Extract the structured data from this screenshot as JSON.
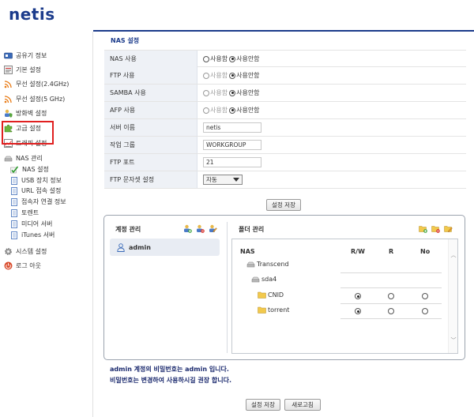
{
  "brand": {
    "logo": "netis",
    "accent": "#1b3b8b"
  },
  "sidebar": {
    "items": [
      {
        "label": "공유기 정보",
        "icon": "router-info-icon"
      },
      {
        "label": "기본 설정",
        "icon": "basic-settings-icon"
      },
      {
        "label": "무선 설정(2.4GHz)",
        "icon": "wireless-icon"
      },
      {
        "label": "무선 설정(5 GHz)",
        "icon": "wireless-icon"
      },
      {
        "label": "방화벽 설정",
        "icon": "firewall-icon"
      },
      {
        "label": "고급 설정",
        "icon": "puzzle-icon"
      },
      {
        "label": "트래픽 설정",
        "icon": "traffic-chart-icon"
      },
      {
        "label": "NAS 관리",
        "icon": "nas-drive-icon"
      },
      {
        "label": "시스템 설정",
        "icon": "gear-icon"
      },
      {
        "label": "로그 아웃",
        "icon": "power-icon"
      }
    ],
    "nas_subitems": [
      {
        "label": "NAS 설정",
        "icon": "check-icon"
      },
      {
        "label": "USB 장치 정보",
        "icon": "document-icon"
      },
      {
        "label": "URL 접속 설정",
        "icon": "document-icon"
      },
      {
        "label": "접속자 연결 정보",
        "icon": "document-icon"
      },
      {
        "label": "토렌트",
        "icon": "document-icon"
      },
      {
        "label": "미디어 서버",
        "icon": "document-icon"
      },
      {
        "label": "iTunes 서버",
        "icon": "document-icon"
      }
    ]
  },
  "main": {
    "title": "NAS 설정",
    "rows": {
      "nas_use": {
        "label": "NAS 사용",
        "opt_on": "사용함",
        "opt_off": "사용안함",
        "selected": "off"
      },
      "ftp_use": {
        "label": "FTP 사용",
        "opt_on": "사용함",
        "opt_off": "사용안함",
        "selected": "off"
      },
      "samba_use": {
        "label": "SAMBA 사용",
        "opt_on": "사용함",
        "opt_off": "사용안함",
        "selected": "off"
      },
      "afp_use": {
        "label": "AFP 사용",
        "opt_on": "사용함",
        "opt_off": "사용안함",
        "selected": "off"
      },
      "server_name": {
        "label": "서버 이름",
        "value": "netis"
      },
      "workgroup": {
        "label": "작업 그룹",
        "value": "WORKGROUP"
      },
      "ftp_port": {
        "label": "FTP 포트",
        "value": "21"
      },
      "ftp_charset": {
        "label": "FTP 문자셋 설정",
        "value": "자동"
      }
    },
    "save_label": "설정 저장"
  },
  "accounts": {
    "title": "계정 관리",
    "users": [
      "admin"
    ]
  },
  "folders": {
    "title": "폴더 관리",
    "columns": {
      "nas": "NAS",
      "rw": "R/W",
      "r": "R",
      "no": "No"
    },
    "tree": [
      {
        "name": "Transcend",
        "level": 0,
        "type": "drive"
      },
      {
        "name": "sda4",
        "level": 1,
        "type": "drive"
      },
      {
        "name": "CNID",
        "level": 2,
        "type": "folder",
        "perm": "rw"
      },
      {
        "name": "torrent",
        "level": 2,
        "type": "folder",
        "perm": "rw"
      }
    ]
  },
  "notes": {
    "line1": "admin 계정의 비밀번호는 admin 입니다.",
    "line2": "비밀번호는 변경하여 사용하시길 권장 합니다."
  },
  "footer": {
    "save_label": "설정 저장",
    "refresh_label": "새로고침"
  }
}
